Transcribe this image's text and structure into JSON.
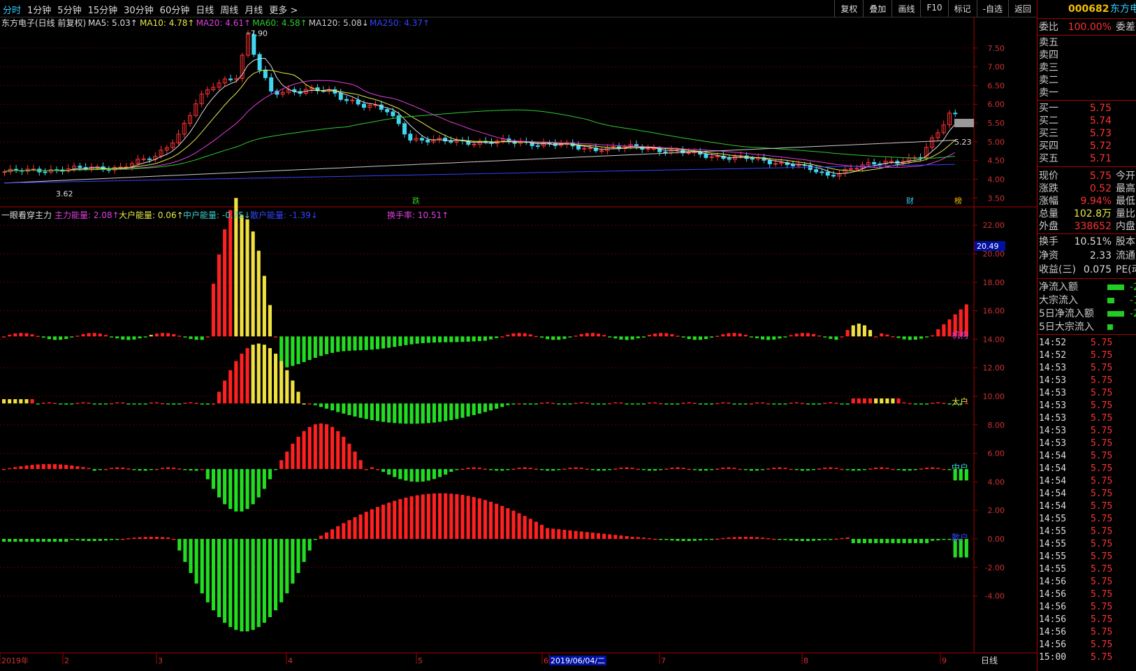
{
  "periods": [
    "分时",
    "1分钟",
    "5分钟",
    "15分钟",
    "30分钟",
    "60分钟",
    "日线",
    "周线",
    "月线",
    "更多 >"
  ],
  "active_period": 0,
  "right_buttons": [
    "复权",
    "叠加",
    "画线",
    "F10",
    "标记",
    "-自选",
    "返回"
  ],
  "stock_code": "000682",
  "stock_name": "东方电",
  "ma_legend": [
    {
      "text": "东方电子(日线 前复权)",
      "color": "#dddddd"
    },
    {
      "text": "MA5: 5.03↑",
      "color": "#dddddd"
    },
    {
      "text": "MA10: 4.78↑",
      "color": "#e8e84a"
    },
    {
      "text": "MA20: 4.61↑",
      "color": "#e040e0"
    },
    {
      "text": "MA60: 4.58↑",
      "color": "#2ecc2e"
    },
    {
      "text": "MA120: 5.08↓",
      "color": "#cccccc"
    },
    {
      "text": "MA250: 4.37↑",
      "color": "#3344ff"
    }
  ],
  "ind_legend": [
    {
      "text": "一眼看穿主力",
      "color": "#dddddd"
    },
    {
      "text": "主力能量: 2.08↑",
      "color": "#e040e0"
    },
    {
      "text": "大户能量: 0.06↑",
      "color": "#e8e84a"
    },
    {
      "text": "中户能量: -0.75↓",
      "color": "#3fd0d0"
    },
    {
      "text": "散户能量: -1.39↓",
      "color": "#3344ff"
    },
    {
      "text": "换手率: 10.51↑",
      "color": "#e040e0"
    }
  ],
  "price_axis": [
    "7.50",
    "7.00",
    "6.50",
    "6.00",
    "5.50",
    "5.00",
    "4.50",
    "4.00",
    "3.50"
  ],
  "ind_axis": [
    "22.00",
    "20.00",
    "18.00",
    "16.00",
    "14.00",
    "12.00",
    "10.00",
    "8.00",
    "6.00",
    "4.00",
    "2.00",
    "0.00",
    "-2.00",
    "-4.00"
  ],
  "ind_axis_highlight": "20.49",
  "high_label": "7.90",
  "low_label": "3.62",
  "last_label": "5.23",
  "event_markers": [
    "跌",
    "财",
    "榜"
  ],
  "band_labels": [
    "机构",
    "大户",
    "中户",
    "散户"
  ],
  "date_axis": [
    "2019年",
    "2",
    "3",
    "4",
    "5",
    "6",
    "2019/06/04/二",
    "7",
    "8",
    "9"
  ],
  "date_axis_right": "日线",
  "quote": {
    "weibi_label": "委比",
    "weibi_value": "100.00%",
    "weicha_label": "委差",
    "sell": [
      {
        "label": "卖五",
        "price": ""
      },
      {
        "label": "卖四",
        "price": ""
      },
      {
        "label": "卖三",
        "price": ""
      },
      {
        "label": "卖二",
        "price": ""
      },
      {
        "label": "卖一",
        "price": ""
      }
    ],
    "buy": [
      {
        "label": "买一",
        "price": "5.75"
      },
      {
        "label": "买二",
        "price": "5.74"
      },
      {
        "label": "买三",
        "price": "5.73"
      },
      {
        "label": "买四",
        "price": "5.72"
      },
      {
        "label": "买五",
        "price": "5.71"
      }
    ],
    "stats": [
      {
        "label": "现价",
        "value": "5.75",
        "extra": "今开",
        "color": "#ff3333"
      },
      {
        "label": "涨跌",
        "value": "0.52",
        "extra": "最高",
        "color": "#ff3333"
      },
      {
        "label": "涨幅",
        "value": "9.94%",
        "extra": "最低",
        "color": "#ff3333"
      },
      {
        "label": "总量",
        "value": "102.8万",
        "extra": "量比",
        "color": "#e8e84a"
      },
      {
        "label": "外盘",
        "value": "338652",
        "extra": "内盘",
        "color": "#ff3333"
      },
      {
        "label": "换手",
        "value": "10.51%",
        "extra": "股本",
        "color": "#dddddd"
      },
      {
        "label": "净资",
        "value": "2.33",
        "extra": "流通",
        "color": "#dddddd"
      },
      {
        "label": "收益(三)",
        "value": "0.075",
        "extra": "PE(动",
        "color": "#dddddd"
      }
    ],
    "flows": [
      {
        "label": "净流入额",
        "value": "-2"
      },
      {
        "label": "大宗流入",
        "value": "-1"
      },
      {
        "label": "5日净流入额",
        "value": "-2"
      },
      {
        "label": "5日大宗流入",
        "value": ""
      }
    ]
  },
  "ticks": [
    {
      "t": "14:52",
      "p": "5.75"
    },
    {
      "t": "14:52",
      "p": "5.75"
    },
    {
      "t": "14:53",
      "p": "5.75"
    },
    {
      "t": "14:53",
      "p": "5.75"
    },
    {
      "t": "14:53",
      "p": "5.75"
    },
    {
      "t": "14:53",
      "p": "5.75"
    },
    {
      "t": "14:53",
      "p": "5.75"
    },
    {
      "t": "14:53",
      "p": "5.75"
    },
    {
      "t": "14:53",
      "p": "5.75"
    },
    {
      "t": "14:54",
      "p": "5.75"
    },
    {
      "t": "14:54",
      "p": "5.75"
    },
    {
      "t": "14:54",
      "p": "5.75"
    },
    {
      "t": "14:54",
      "p": "5.75"
    },
    {
      "t": "14:54",
      "p": "5.75"
    },
    {
      "t": "14:55",
      "p": "5.75"
    },
    {
      "t": "14:55",
      "p": "5.75"
    },
    {
      "t": "14:55",
      "p": "5.75"
    },
    {
      "t": "14:55",
      "p": "5.75"
    },
    {
      "t": "14:55",
      "p": "5.75"
    },
    {
      "t": "14:56",
      "p": "5.75"
    },
    {
      "t": "14:56",
      "p": "5.75"
    },
    {
      "t": "14:56",
      "p": "5.75"
    },
    {
      "t": "14:56",
      "p": "5.75"
    },
    {
      "t": "14:56",
      "p": "5.75"
    },
    {
      "t": "14:56",
      "p": "5.75"
    },
    {
      "t": "15:00",
      "p": "5.75"
    }
  ],
  "chart_data": {
    "type": "candlestick",
    "price_range": [
      3.3,
      8.0
    ],
    "ma_series": [
      "MA5",
      "MA10",
      "MA20",
      "MA60",
      "MA120",
      "MA250"
    ],
    "indicator_range": [
      -6.0,
      23.0
    ],
    "indicator_series": [
      "主力能量",
      "大户能量",
      "中户能量",
      "散户能量"
    ],
    "colors": {
      "up": "#ff3333",
      "down": "#3fd6f0",
      "neg": "#22dd22",
      "pos": "#ff2020",
      "yellow": "#f0e040"
    }
  }
}
